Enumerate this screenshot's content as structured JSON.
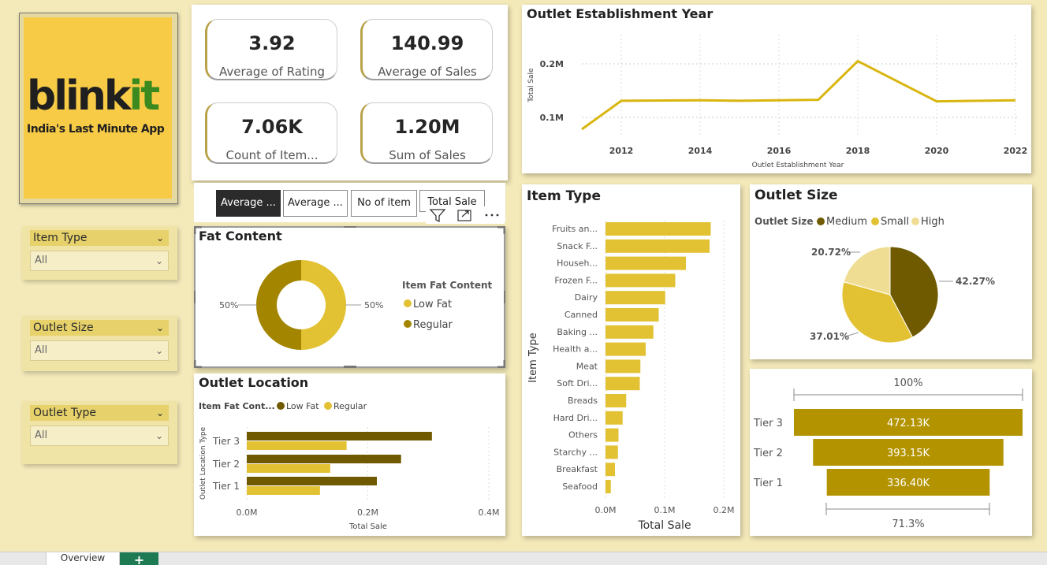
{
  "logo": {
    "word_main": "blink",
    "word_accent": "it",
    "tagline": "India's Last Minute App"
  },
  "kpis": [
    {
      "value": "3.92",
      "label": "Average of Rating"
    },
    {
      "value": "140.99",
      "label": "Average of Sales"
    },
    {
      "value": "7.06K",
      "label": "Count of Item..."
    },
    {
      "value": "1.20M",
      "label": "Sum of Sales"
    }
  ],
  "slicers": [
    {
      "title": "Item Type",
      "value": "All"
    },
    {
      "title": "Outlet Size",
      "value": "All"
    },
    {
      "title": "Outlet Type",
      "value": "All"
    }
  ],
  "buttons": [
    "Average ...",
    "Average ...",
    "No of item",
    "Total Sale"
  ],
  "visual_header_icons": [
    "filter-icon",
    "focus-mode-icon",
    "more-options-icon"
  ],
  "colors": {
    "dark": "#6f5a00",
    "gold": "#e2c233",
    "olive": "#a38500",
    "light": "#f0dd94",
    "line": "#d9b60f",
    "funnel": "#b39400"
  },
  "bottom_tab": {
    "label": "Overview",
    "add": "+"
  },
  "chart_data": [
    {
      "id": "establishment",
      "type": "line",
      "title": "Outlet Establishment Year",
      "xlabel": "Outlet Establishment Year",
      "ylabel": "Total Sale",
      "x": [
        2011,
        2012,
        2014,
        2015,
        2016,
        2017,
        2018,
        2020,
        2022
      ],
      "values": [
        78000,
        131000,
        132000,
        131000,
        132000,
        133000,
        205000,
        130000,
        132000
      ],
      "xticks": [
        "2012",
        "2014",
        "2016",
        "2018",
        "2020",
        "2022"
      ],
      "yticks": [
        "0.1M",
        "0.2M"
      ],
      "grid": true
    },
    {
      "id": "fat_content",
      "type": "pie",
      "title": "Fat Content",
      "legend_title": "Item Fat Content",
      "slices": [
        {
          "name": "Low Fat",
          "value": 50,
          "label": "50%"
        },
        {
          "name": "Regular",
          "value": 50,
          "label": "50%"
        }
      ],
      "donut": true,
      "legend": "right"
    },
    {
      "id": "outlet_location",
      "type": "bar",
      "orientation": "horizontal",
      "title": "Outlet Location",
      "legend_title": "Item Fat Cont...",
      "categories": [
        "Tier 3",
        "Tier 2",
        "Tier 1"
      ],
      "series": [
        {
          "name": "Low Fat",
          "values": [
            306000,
            255000,
            215000
          ]
        },
        {
          "name": "Regular",
          "values": [
            165000,
            138000,
            121000
          ]
        }
      ],
      "xlabel": "Total Sale",
      "ylabel": "Outlet Location Type",
      "xticks": [
        "0.0M",
        "0.2M",
        "0.4M"
      ],
      "xlim": [
        0,
        400000
      ],
      "legend": "top-left"
    },
    {
      "id": "item_type",
      "type": "bar",
      "orientation": "horizontal",
      "title": "Item Type",
      "categories": [
        "Fruits an...",
        "Snack F...",
        "Househ...",
        "Frozen F...",
        "Dairy",
        "Canned",
        "Baking ...",
        "Health a...",
        "Meat",
        "Soft Dri...",
        "Breads",
        "Hard Dri...",
        "Others",
        "Starchy ...",
        "Breakfast",
        "Seafood"
      ],
      "values": [
        178000,
        176000,
        136000,
        118000,
        101000,
        90000,
        81000,
        68000,
        59000,
        58000,
        35000,
        29000,
        22000,
        21000,
        16000,
        9000
      ],
      "xlabel": "Total Sale",
      "ylabel": "Item Type",
      "xticks": [
        "0.0M",
        "0.1M",
        "0.2M"
      ],
      "xlim": [
        0,
        200000
      ]
    },
    {
      "id": "outlet_size",
      "type": "pie",
      "title": "Outlet Size",
      "legend_title": "Outlet Size",
      "slices": [
        {
          "name": "Medium",
          "value": 42.27,
          "label": "42.27%"
        },
        {
          "name": "Small",
          "value": 37.01,
          "label": "37.01%"
        },
        {
          "name": "High",
          "value": 20.72,
          "label": "20.72%"
        }
      ],
      "legend": "top-left"
    },
    {
      "id": "funnel",
      "type": "bar",
      "subtype": "funnel",
      "categories": [
        "Tier 3",
        "Tier 2",
        "Tier 1"
      ],
      "values": [
        472130,
        393150,
        336400
      ],
      "value_labels": [
        "472.13K",
        "393.15K",
        "336.40K"
      ],
      "top_label": "100%",
      "bottom_label": "71.3%"
    }
  ]
}
